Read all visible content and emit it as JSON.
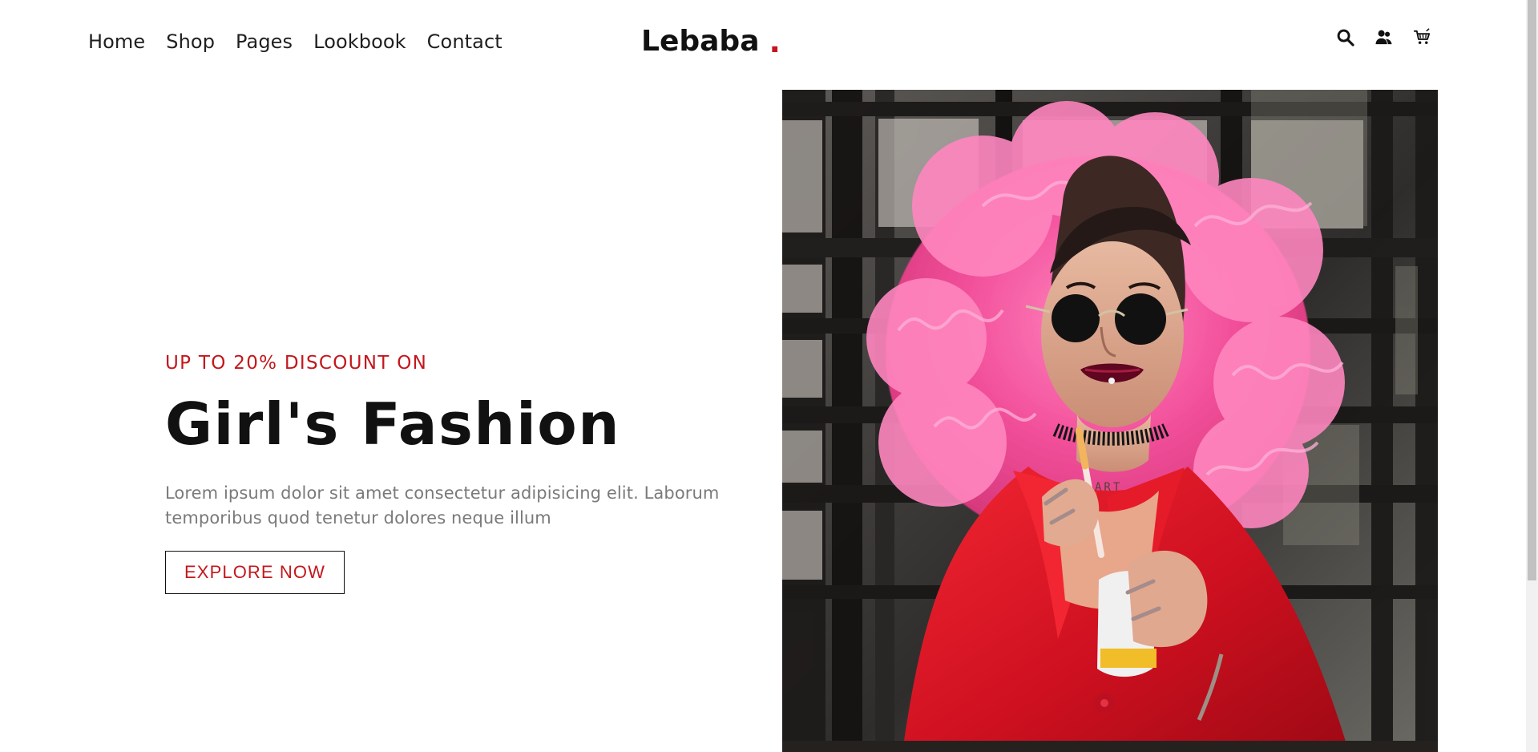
{
  "header": {
    "nav": [
      {
        "label": "Home"
      },
      {
        "label": "Shop"
      },
      {
        "label": "Pages"
      },
      {
        "label": "Lookbook"
      },
      {
        "label": "Contact"
      }
    ],
    "logo": {
      "text": "Lebaba",
      "dot": "."
    },
    "icons": [
      {
        "name": "search-icon"
      },
      {
        "name": "user-icon"
      },
      {
        "name": "cart-icon"
      }
    ]
  },
  "hero": {
    "eyebrow": "UP TO 20% DISCOUNT ON",
    "title": "Girl's Fashion",
    "description": "Lorem ipsum dolor sit amet consectetur adipisicing elit. Laborum temporibus quod tenetur dolores neque illum",
    "button_label": "EXPLORE NOW",
    "image": {
      "semantic": "woman with pink curly hair, sunglasses, red blazer"
    }
  },
  "colors": {
    "accent": "#c3171d",
    "text": "#111111",
    "muted_text": "#7a7a7a"
  }
}
